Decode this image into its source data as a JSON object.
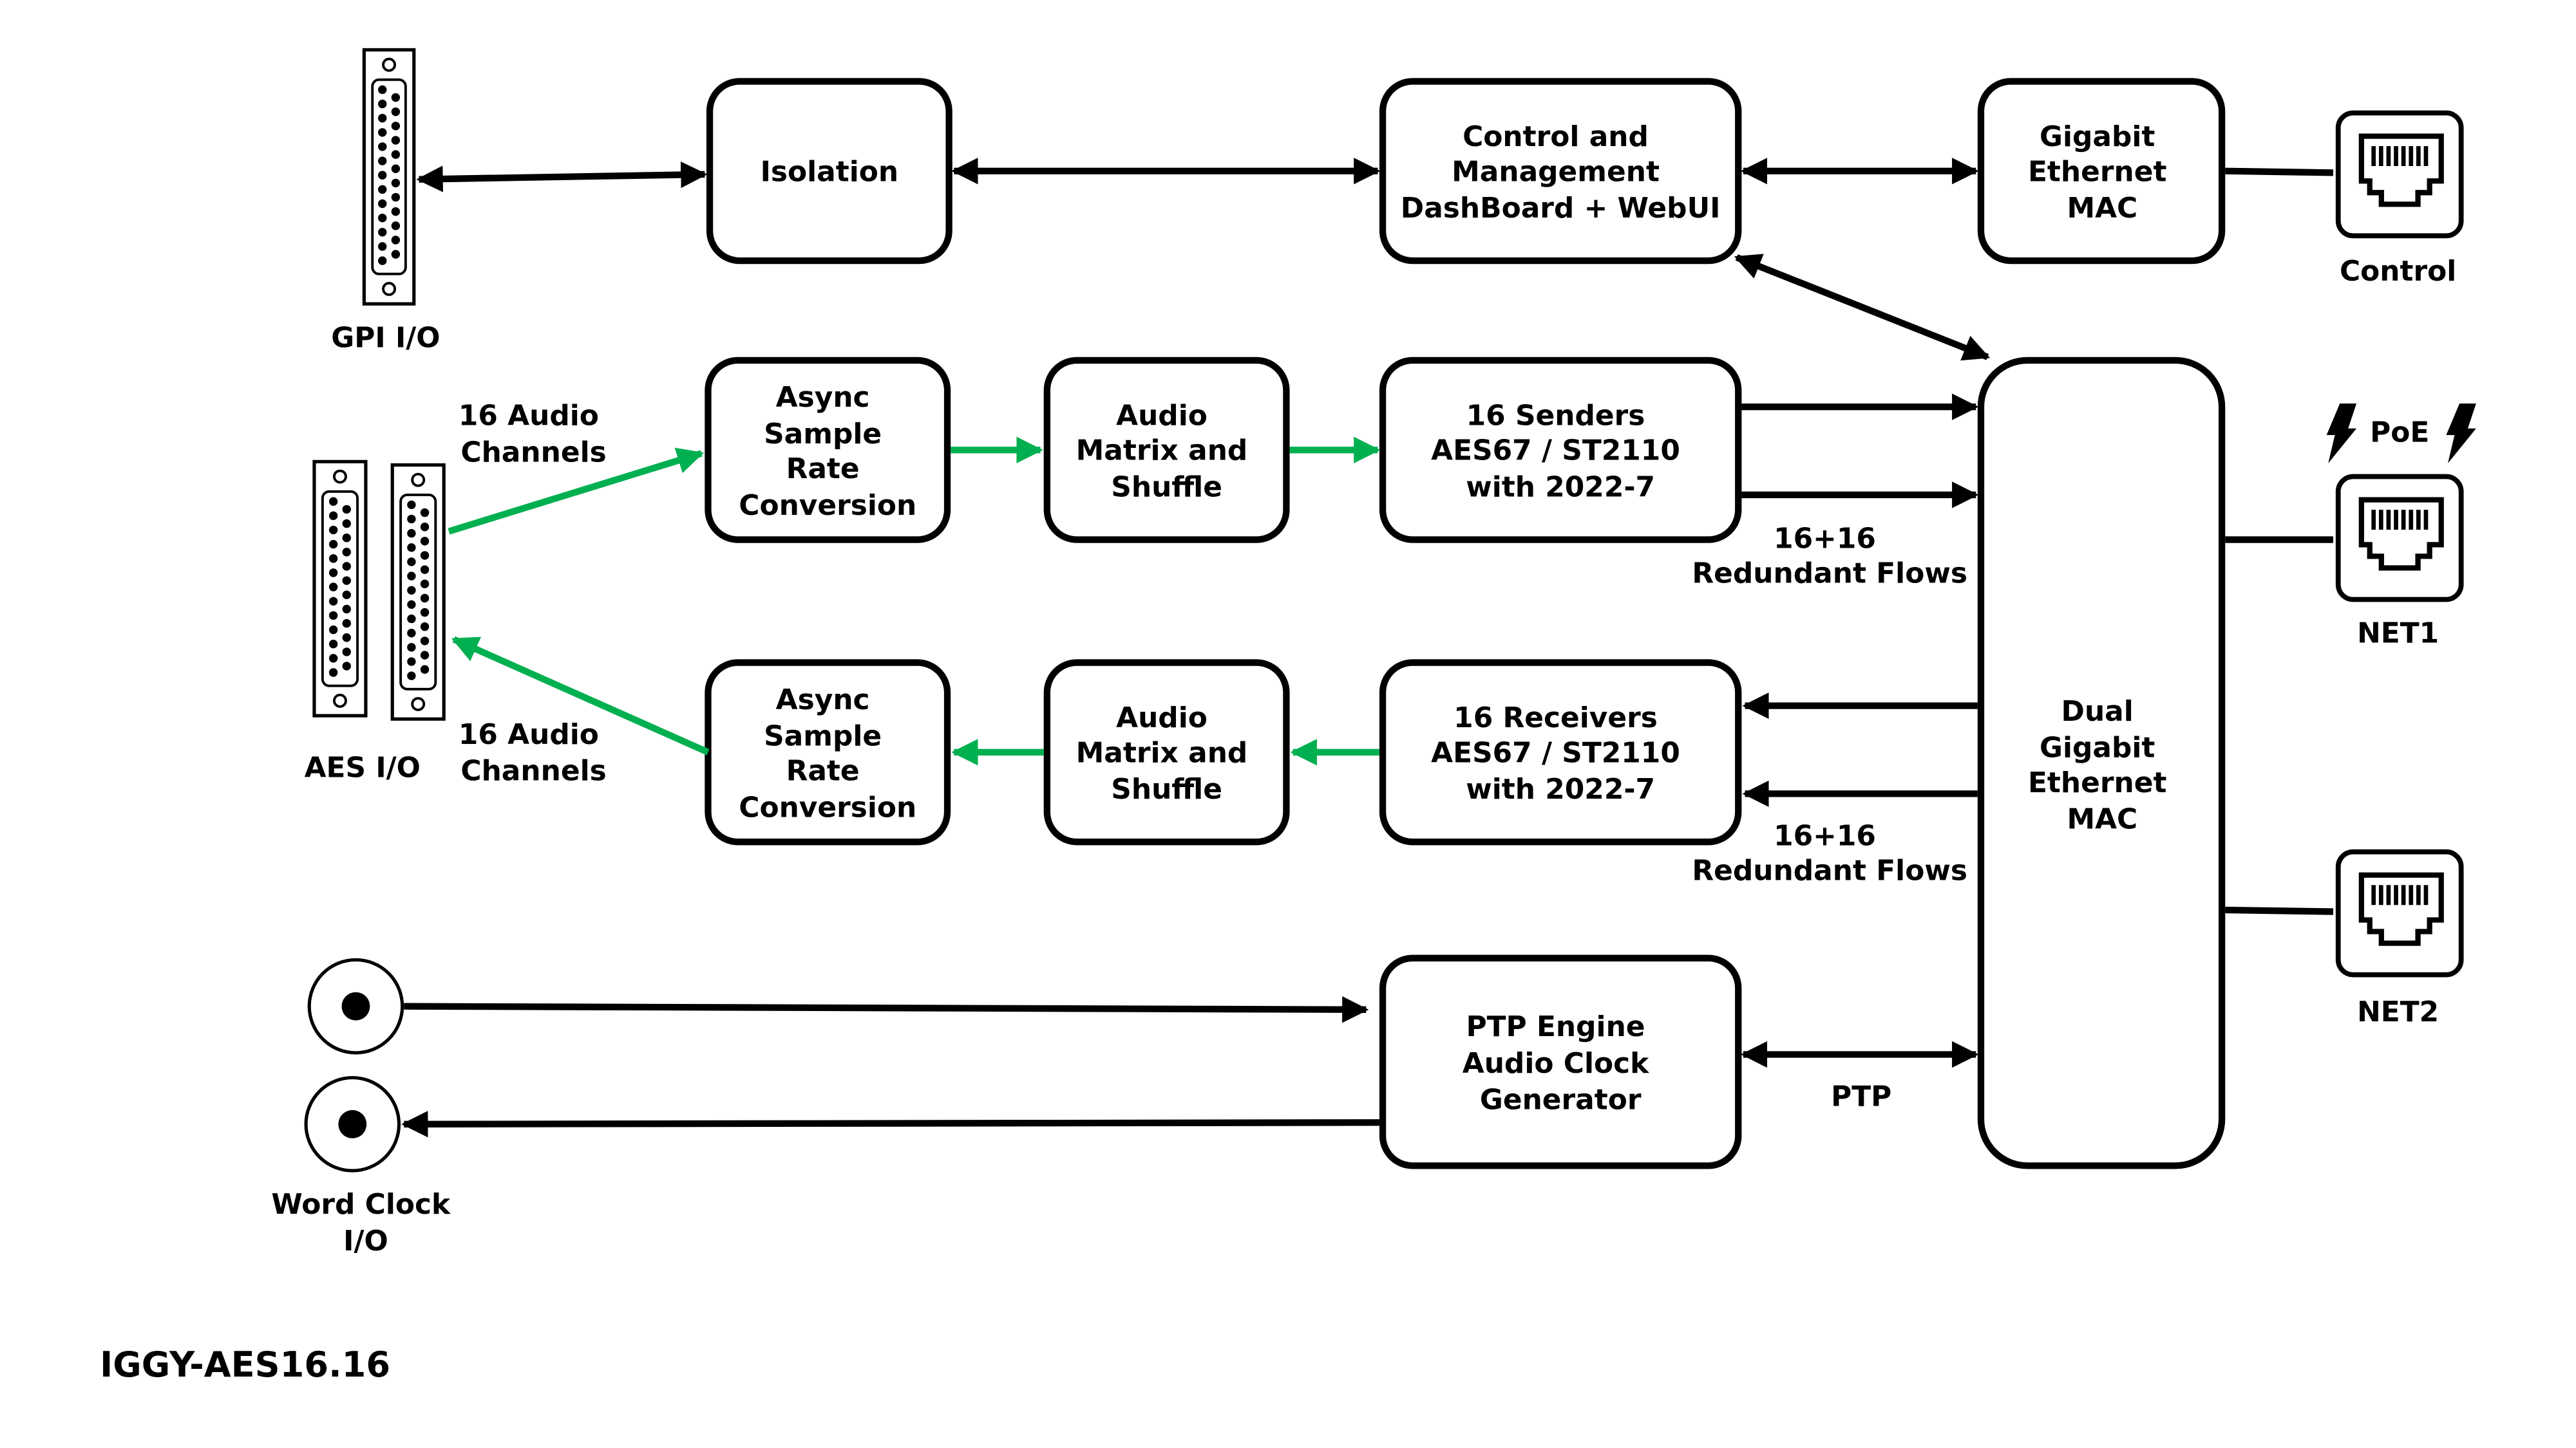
{
  "title": "IGGY-AES16.16",
  "colors": {
    "signal_green": "#00B050",
    "line_black": "#000000",
    "background": "#ffffff"
  },
  "blocks": {
    "isolation": [
      "Isolation"
    ],
    "control": [
      "Control and",
      "Management",
      "DashBoard + WebUI"
    ],
    "gige_mac": [
      "Gigabit",
      "Ethernet",
      "MAC"
    ],
    "src_in": [
      "Async",
      "Sample",
      "Rate",
      "Conversion"
    ],
    "matrix_in": [
      "Audio",
      "Matrix and",
      "Shuffle"
    ],
    "senders": [
      "16 Senders",
      "AES67 / ST2110",
      "with 2022-7"
    ],
    "src_out": [
      "Async",
      "Sample",
      "Rate",
      "Conversion"
    ],
    "matrix_out": [
      "Audio",
      "Matrix and",
      "Shuffle"
    ],
    "receivers": [
      "16 Receivers",
      "AES67 / ST2110",
      "with 2022-7"
    ],
    "dual_mac": [
      "Dual",
      "Gigabit",
      "Ethernet",
      "MAC"
    ],
    "ptp": [
      "PTP Engine",
      "Audio Clock",
      "Generator"
    ]
  },
  "labels": {
    "gpi": "GPI I/O",
    "aes": "AES I/O",
    "aes_in_ch": [
      "16 Audio",
      "Channels"
    ],
    "aes_out_ch": [
      "16 Audio",
      "Channels"
    ],
    "tx_flows": [
      "16+16",
      "Redundant Flows"
    ],
    "rx_flows": [
      "16+16",
      "Redundant Flows"
    ],
    "ptp_link": "PTP",
    "word_clock": [
      "Word Clock",
      "I/O"
    ],
    "control_port": "Control",
    "net1": "NET1",
    "net2": "NET2",
    "poe": "PoE"
  },
  "icons": {
    "gpi_connector": "db-connector-icon",
    "aes_connectors": "db-connector-icon",
    "bnc": "bnc-connector-icon",
    "rj45": "rj45-port-icon",
    "poe": "lightning-bolt-icon"
  }
}
